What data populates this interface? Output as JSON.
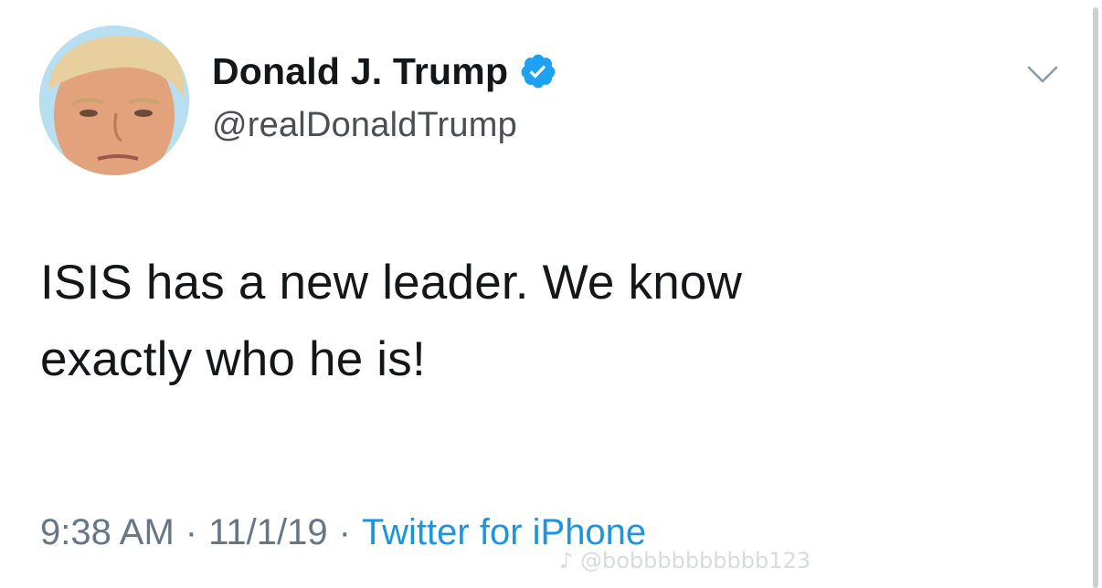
{
  "user": {
    "display_name": "Donald J. Trump",
    "handle": "@realDonaldTrump",
    "verified": true
  },
  "tweet": {
    "text_line1": "ISIS has a new leader. We know",
    "text_line2": "exactly who he is!"
  },
  "meta": {
    "time": "9:38 AM",
    "separator": "·",
    "date": "11/1/19",
    "source": "Twitter for iPhone"
  },
  "watermark": {
    "text": "@bobbbbbbbbbb123"
  },
  "colors": {
    "verified_blue": "#1da1f2",
    "source_link": "#1b95e0",
    "meta_gray": "#657786",
    "text": "#14171a"
  },
  "icons": {
    "verified": "verified-badge-icon",
    "menu": "chevron-down-icon",
    "watermark_logo": "tiktok-logo-icon"
  }
}
